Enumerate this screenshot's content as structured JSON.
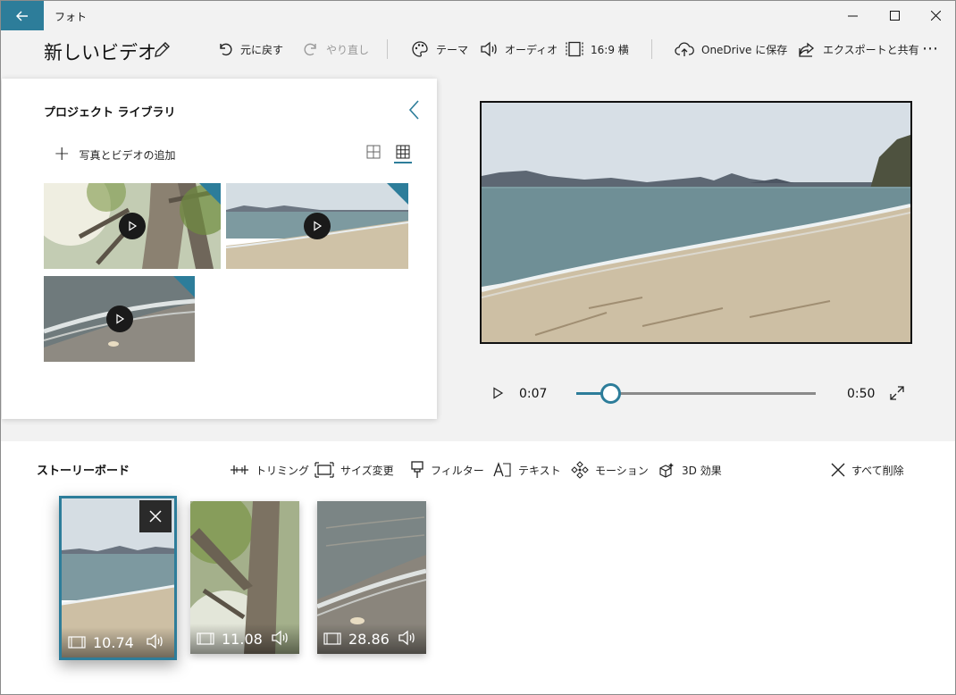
{
  "window": {
    "app_title": "フォト"
  },
  "toolbar": {
    "video_title": "新しいビデオ",
    "undo": "元に戻す",
    "redo": "やり直し",
    "theme": "テーマ",
    "audio": "オーディオ",
    "aspect": "16:9 横",
    "onedrive": "OneDrive に保存",
    "export": "エクスポートと共有",
    "more": "⋯"
  },
  "library": {
    "title": "プロジェクト ライブラリ",
    "add_label": "写真とビデオの追加",
    "items": [
      {
        "kind": "video",
        "icon": "play-icon"
      },
      {
        "kind": "video",
        "icon": "play-icon"
      },
      {
        "kind": "video",
        "icon": "play-icon"
      }
    ]
  },
  "player": {
    "current_time": "0:07",
    "end_time": "0:50",
    "progress": 0.14
  },
  "storyboard": {
    "title": "ストーリーボード",
    "tools": {
      "trim": "トリミング",
      "resize": "サイズ変更",
      "filter": "フィルター",
      "text": "テキスト",
      "motion": "モーション",
      "effects3d": "3D 効果",
      "delete_all": "すべて削除"
    },
    "clips": [
      {
        "duration": "10.74",
        "selected": true
      },
      {
        "duration": "11.08",
        "selected": false
      },
      {
        "duration": "28.86",
        "selected": false
      }
    ]
  },
  "colors": {
    "accent": "#2d7d9a"
  }
}
